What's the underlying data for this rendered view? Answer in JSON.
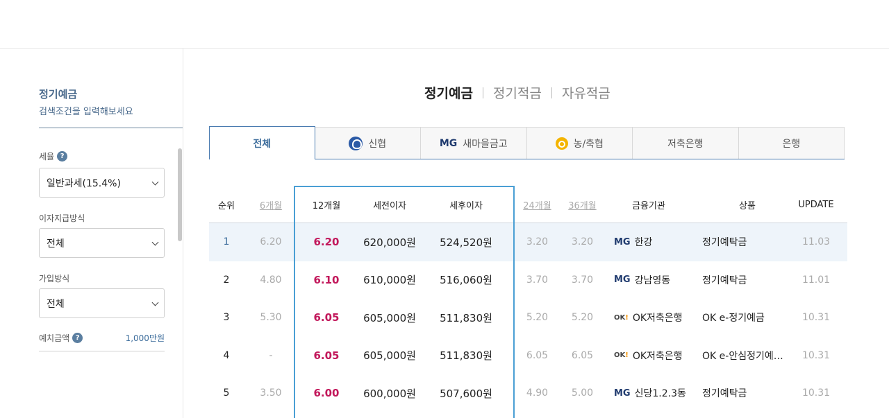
{
  "sidebar": {
    "title": "정기예금",
    "subtitle": "검색조건을 입력해보세요",
    "tax_label": "세율",
    "tax_value": "일반과세(15.4%)",
    "interest_label": "이자지급방식",
    "interest_value": "전체",
    "join_label": "가입방식",
    "join_value": "전체",
    "deposit_label": "예치금액",
    "deposit_value": "1,000만원"
  },
  "categories": [
    "정기예금",
    "정기적금",
    "자유적금"
  ],
  "tabs": [
    {
      "label": "전체",
      "icon": ""
    },
    {
      "label": "신협",
      "icon": "cu-logo-icon"
    },
    {
      "label": "새마을금고",
      "icon": "MG"
    },
    {
      "label": "농/축협",
      "icon": "nh-logo-icon"
    },
    {
      "label": "저축은행",
      "icon": ""
    },
    {
      "label": "은행",
      "icon": ""
    }
  ],
  "table": {
    "headers": {
      "rank": "순위",
      "m6": "6개월",
      "m12": "12개월",
      "pre": "세전이자",
      "post": "세후이자",
      "m24": "24개월",
      "m36": "36개월",
      "inst": "금융기관",
      "prod": "상품",
      "upd": "UPDATE"
    },
    "rows": [
      {
        "rank": "1",
        "m6": "6.20",
        "m12": "6.20",
        "pre": "620,000원",
        "post": "524,520원",
        "m24": "3.20",
        "m36": "3.20",
        "logo": "MG",
        "inst": "한강",
        "prod": "정기예탁금",
        "upd": "11.03"
      },
      {
        "rank": "2",
        "m6": "4.80",
        "m12": "6.10",
        "pre": "610,000원",
        "post": "516,060원",
        "m24": "3.70",
        "m36": "3.70",
        "logo": "MG",
        "inst": "강남영동",
        "prod": "정기예탁금",
        "upd": "11.01"
      },
      {
        "rank": "3",
        "m6": "5.30",
        "m12": "6.05",
        "pre": "605,000원",
        "post": "511,830원",
        "m24": "5.20",
        "m36": "5.20",
        "logo": "OK",
        "inst": "OK저축은행",
        "prod": "OK e-정기예금",
        "upd": "10.31"
      },
      {
        "rank": "4",
        "m6": "-",
        "m12": "6.05",
        "pre": "605,000원",
        "post": "511,830원",
        "m24": "6.05",
        "m36": "6.05",
        "logo": "OK",
        "inst": "OK저축은행",
        "prod": "OK e-안심정기예…",
        "upd": "10.31"
      },
      {
        "rank": "5",
        "m6": "3.50",
        "m12": "6.00",
        "pre": "600,000원",
        "post": "507,600원",
        "m24": "4.90",
        "m36": "5.00",
        "logo": "MG",
        "inst": "신당1.2.3동",
        "prod": "정기예탁금",
        "upd": "10.31"
      }
    ]
  },
  "colors": {
    "accent": "#3d6d9c",
    "rate": "#c2185b",
    "highlight_border": "#4a9fd4"
  }
}
